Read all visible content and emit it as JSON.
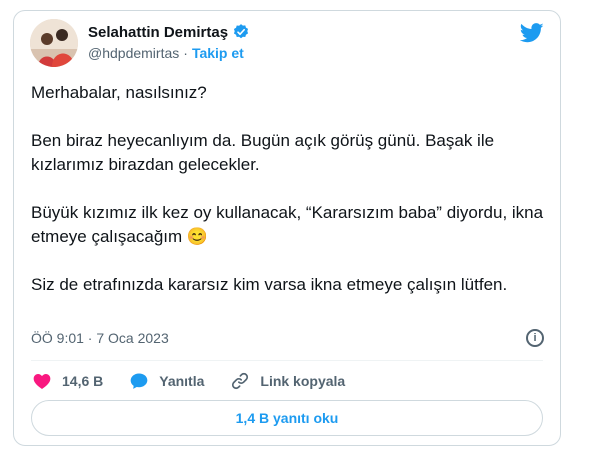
{
  "author": {
    "name": "Selahattin Demirtaş",
    "handle": "@hdpdemirtas",
    "separator": "·",
    "follow_label": "Takip et"
  },
  "tweet": {
    "paragraphs": [
      "Merhabalar, nasılsınız?",
      "Ben biraz heyecanlıyım da. Bugün açık görüş günü. Başak ile kızlarımız birazdan gelecekler.",
      "Büyük kızımız ilk kez oy kullanacak, “Kararsızım baba” diyordu, ikna etmeye çalışacağım",
      "Siz de etrafınızda kararsız kim varsa ikna etmeye çalışın lütfen."
    ],
    "emoji": "😊",
    "timestamp": "ÖÖ 9:01 · 7 Oca 2023"
  },
  "actions": {
    "likes": "14,6 B",
    "reply_label": "Yanıtla",
    "copy_link_label": "Link kopyala",
    "read_replies_label": "1,4 B yanıtı oku"
  },
  "colors": {
    "accent": "#1d9bf0",
    "like": "#f91880",
    "text": "#0f1419",
    "muted": "#536471"
  },
  "icons": [
    "verified-badge-icon",
    "twitter-bird-icon",
    "info-icon",
    "heart-icon",
    "reply-bubble-icon",
    "link-icon"
  ]
}
